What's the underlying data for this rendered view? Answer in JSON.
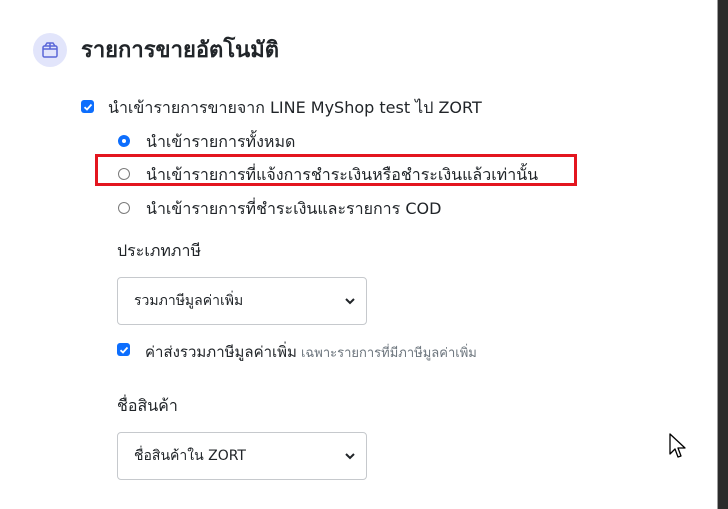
{
  "section": {
    "title": "รายการขายอัตโนมัติ",
    "icon": "box-icon"
  },
  "import_toggle": {
    "label": "นำเข้ารายการขายจาก LINE MyShop test ไป ZORT",
    "checked": true
  },
  "import_options": [
    {
      "label": "นำเข้ารายการทั้งหมด",
      "selected": true
    },
    {
      "label": "นำเข้ารายการที่แจ้งการชำระเงินหรือชำระเงินแล้วเท่านั้น",
      "selected": false,
      "highlighted": true
    },
    {
      "label": "นำเข้ารายการที่ชำระเงินและรายการ COD",
      "selected": false
    }
  ],
  "tax_type": {
    "label": "ประเภทภาษี",
    "selected": "รวมภาษีมูลค่าเพิ่ม"
  },
  "shipping_vat": {
    "label": "ค่าส่งรวมภาษีมูลค่าเพิ่ม",
    "note": "เฉพาะรายการที่มีภาษีมูลค่าเพิ่ม",
    "checked": true
  },
  "product_name": {
    "label": "ชื่อสินค้า",
    "selected": "ชื่อสินค้าใน ZORT"
  },
  "colors": {
    "accent": "#0d6efd",
    "highlight": "#e3151f",
    "icon_bg": "#e2e5fb"
  }
}
